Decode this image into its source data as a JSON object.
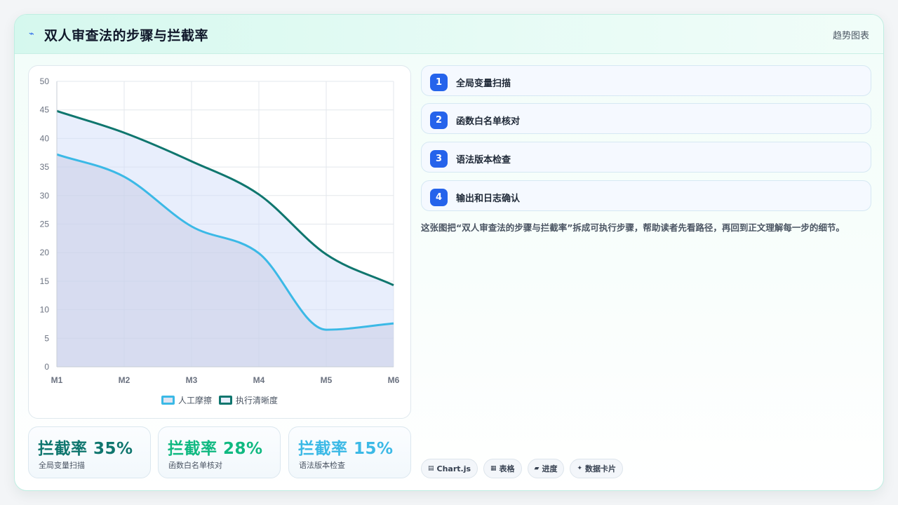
{
  "header": {
    "icon": "lightning-icon",
    "title": "双人审查法的步骤与拦截率",
    "tag": "趋势图表"
  },
  "chart_data": {
    "type": "line",
    "categories": [
      "M1",
      "M2",
      "M3",
      "M4",
      "M5",
      "M6"
    ],
    "y_ticks": [
      "0",
      "5",
      "10",
      "15",
      "20",
      "25",
      "30",
      "35",
      "40",
      "45",
      "50"
    ],
    "ylim": [
      0,
      50
    ],
    "grid": true,
    "legend_position": "bottom",
    "series": [
      {
        "name": "人工摩擦",
        "values": [
          37.2,
          33.3,
          24.6,
          19.9,
          6.5,
          7.6
        ],
        "color": "#3bb9e6",
        "fill": "rgba(200,205,230,0.55)"
      },
      {
        "name": "执行清晰度",
        "values": [
          44.8,
          41.0,
          36.0,
          30.2,
          19.7,
          14.3
        ],
        "color": "#0f766e",
        "fill": "rgba(210,222,250,0.5)"
      }
    ]
  },
  "kpis": [
    {
      "value": "拦截率 35%",
      "label": "全局变量扫描",
      "color": "#0f766e"
    },
    {
      "value": "拦截率 28%",
      "label": "函数白名单核对",
      "color": "#10b981"
    },
    {
      "value": "拦截率 15%",
      "label": "语法版本检查",
      "color": "#3bb9e6"
    }
  ],
  "steps": [
    {
      "num": "1",
      "label": "全局变量扫描"
    },
    {
      "num": "2",
      "label": "函数白名单核对"
    },
    {
      "num": "3",
      "label": "语法版本检查"
    },
    {
      "num": "4",
      "label": "输出和日志确认"
    }
  ],
  "description": "这张图把“双人审查法的步骤与拦截率”拆成可执行步骤，帮助读者先看路径，再回到正文理解每一步的细节。",
  "chips": [
    {
      "icon": "chart-icon",
      "glyph": "▤",
      "label": "Chart.js"
    },
    {
      "icon": "table-icon",
      "glyph": "▦",
      "label": "表格"
    },
    {
      "icon": "progress-icon",
      "glyph": "▰",
      "label": "进度"
    },
    {
      "icon": "card-icon",
      "glyph": "✦",
      "label": "数据卡片"
    }
  ]
}
